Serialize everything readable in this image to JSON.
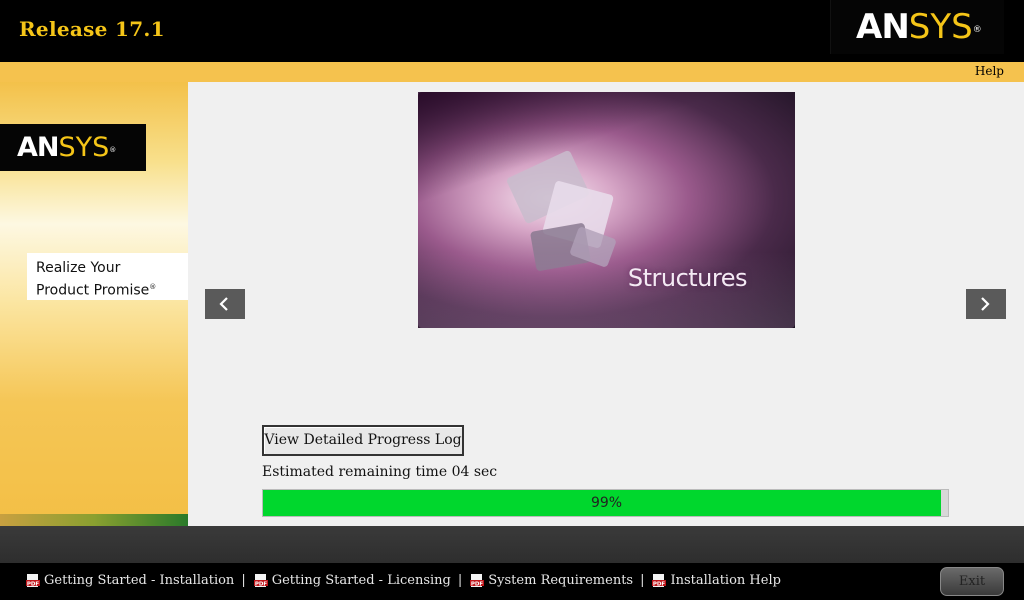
{
  "header": {
    "release_title": "Release 17.1",
    "logo": {
      "an": "ANSYS",
      "reg": "®"
    }
  },
  "help_label": "Help",
  "sidebar": {
    "logo": "ANSYS",
    "tagline_line1": "Realize Your",
    "tagline_line2": "Product Promise",
    "tagline_mark": "®"
  },
  "slideshow": {
    "caption": "Structures",
    "prev_icon": "chevron-left-icon",
    "next_icon": "chevron-right-icon"
  },
  "progress": {
    "log_button_label": "View Detailed Progress Log",
    "eta_text": "Estimated remaining time 04 sec",
    "percent_label": "99%",
    "percent_value": 99
  },
  "footer": {
    "links": [
      {
        "label": "Getting Started - Installation",
        "icon": "pdf-icon"
      },
      {
        "label": "Getting Started - Licensing",
        "icon": "pdf-icon"
      },
      {
        "label": "System Requirements",
        "icon": "pdf-icon"
      },
      {
        "label": "Installation Help",
        "icon": "pdf-icon"
      }
    ],
    "separator": "|",
    "exit_label": "Exit"
  },
  "colors": {
    "brand_yellow": "#f5c518",
    "progress_green": "#00d72d",
    "pdf_red": "#c0161b"
  }
}
